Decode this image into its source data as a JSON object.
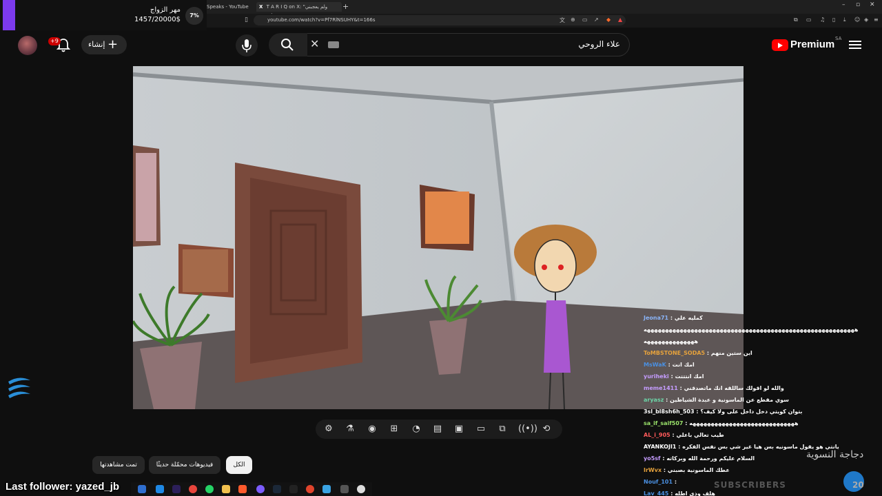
{
  "browser": {
    "tabs": [
      {
        "title": "Speaks - YouTube"
      },
      {
        "title": "T A R I Q on X: \"ولم يعجبني أسلوبه"
      }
    ],
    "url": "youtube.com/watch?v=Pf7RlNSUHY&t=166s"
  },
  "goal_widget": {
    "title": "مهر الزواج",
    "amount": "1457/20000$",
    "percent": "7%",
    "progress_fraction": 0.07,
    "accent_color": "#7c3aed"
  },
  "header": {
    "notifications_badge": "+9",
    "create_label": "إنشاء",
    "search_query": "علاء الروحي",
    "logo_text": "Premium",
    "region": "SA"
  },
  "player_toolbar": {
    "icons": [
      "settings-icon",
      "lab-icon",
      "camera-icon",
      "add-clip-icon",
      "speed-icon",
      "subtitles-icon",
      "picture-in-picture-icon",
      "theater-icon",
      "cast-icon",
      "live-icon",
      "loop-icon"
    ]
  },
  "chat": {
    "lines": [
      {
        "user": "Jeona71",
        "msg": "كمليه علي",
        "color": "#8ab4f8"
      },
      {
        "user": "",
        "msg": "ههههههههههههههههههههههههههههههههههههههههههههههههههههههههههه",
        "color": "#ffffff"
      },
      {
        "user": "",
        "msg": "ههههههههههههههه",
        "color": "#ffffff"
      },
      {
        "user": "ToMBSTONE_SODA5",
        "msg": "اين ستين منهم",
        "color": "#e6a23c"
      },
      {
        "user": "MsWaK",
        "msg": "امك انت",
        "color": "#4a90e2"
      },
      {
        "user": "yuriheki",
        "msg": "امك انتتتت",
        "color": "#c59cff"
      },
      {
        "user": "meme1411",
        "msg": "والله لو اقولك ساللقه انك ماتصدقني",
        "color": "#c59cff"
      },
      {
        "user": "aryasz",
        "msg": "سوي مقطع عن الماسونية و عبدة الشياطين",
        "color": "#6dd3a6"
      },
      {
        "user": "3sl_bl8sh6h_503",
        "msg": "بتوان كويتي دخل داخل على ولا كيف؟",
        "color": "#ffffff"
      },
      {
        "user": "sa_if_saif507",
        "msg": "هههههههههههههههههههههههههههههه",
        "color": "#9be36b"
      },
      {
        "user": "AL_i_905",
        "msg": "طيب تعالي باعلي",
        "color": "#ff5a5a"
      },
      {
        "user": "AYANKOJI1",
        "msg": "يانتي هو يقول ماسونيه بس هيا غير شي بس نفس الفكره",
        "color": "#ffffff"
      },
      {
        "user": "yo5sf",
        "msg": "السلام عليكم ورحمة الله وبركاته",
        "color": "#c59cff"
      },
      {
        "user": "IrWvx",
        "msg": "عطك الماسونية بصبني",
        "color": "#e6a23c"
      },
      {
        "user": "Nouf_101",
        "msg": "",
        "color": "#4a90e2"
      },
      {
        "user": "Lav_445",
        "msg": "هلف وذي اطله",
        "color": "#4a90e2"
      }
    ]
  },
  "overlay": {
    "streamer_name": "دجاجة النسوية",
    "subs_label": "SUBSCRIBERS",
    "subs_count": "20",
    "last_follower": "Last follower: yazed_jb"
  },
  "chips": {
    "all": "الكل",
    "recent": "فيديوهات محمّلة حديثًا",
    "watched": "تمت مشاهدتها"
  },
  "colors": {
    "youtube_red": "#ff0000",
    "background": "#0f0f0f"
  }
}
